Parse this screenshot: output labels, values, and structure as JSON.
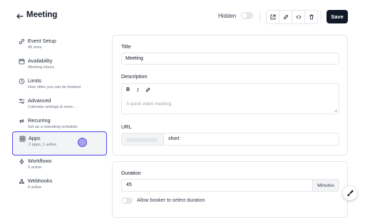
{
  "header": {
    "title": "Meeting",
    "hidden_label": "Hidden",
    "save_label": "Save",
    "toolbar_icons": [
      "external-link-icon",
      "link-icon",
      "code-icon",
      "trash-icon"
    ]
  },
  "sidebar": {
    "items": [
      {
        "label": "Event Setup",
        "sub": "45 mins",
        "icon": "link-icon"
      },
      {
        "label": "Availability",
        "sub": "Working Hours",
        "icon": "calendar-icon"
      },
      {
        "label": "Limits",
        "sub": "How often you can be booked",
        "icon": "clock-icon"
      },
      {
        "label": "Advanced",
        "sub": "Calendar settings & more...",
        "icon": "sliders-icon"
      },
      {
        "label": "Recurring",
        "sub": "Set up a repeating schedule",
        "icon": "repeat-icon"
      },
      {
        "label": "Apps",
        "sub": "2 apps, 1 active",
        "icon": "grid-icon",
        "active": true
      },
      {
        "label": "Workflows",
        "sub": "0 active",
        "icon": "zap-icon"
      },
      {
        "label": "Webhooks",
        "sub": "0 active",
        "icon": "webhook-icon"
      }
    ]
  },
  "form": {
    "title_label": "Title",
    "title_value": "Meeting",
    "description_label": "Description",
    "description_placeholder": "A quick video meeting.",
    "url_label": "URL",
    "url_value": "short",
    "duration_label": "Duration",
    "duration_value": "45",
    "duration_unit": "Minutes",
    "allow_booker_label": "Allow booker to select duration"
  },
  "colors": {
    "accent": "#4f46e5",
    "save_bg": "#111827"
  }
}
